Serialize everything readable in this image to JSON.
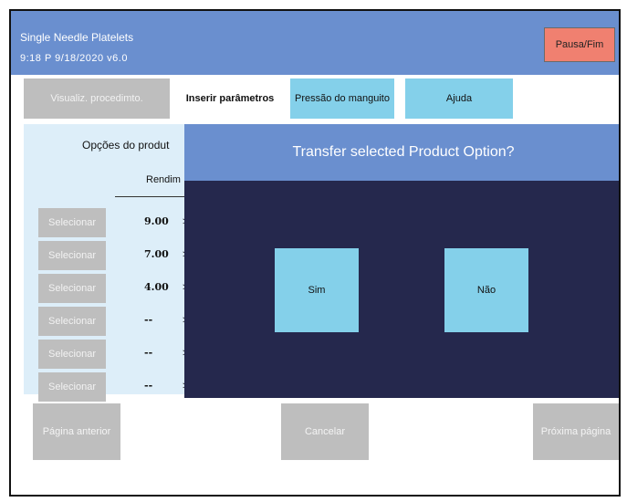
{
  "header": {
    "app_title": "Single Needle Platelets",
    "status_line": "9:18 P  9/18/2020   v6.0",
    "pause_label": "Pausa/Fim"
  },
  "tabs": [
    {
      "label": "Visualiz. procedimto."
    },
    {
      "label": "Inserir parâmetros"
    },
    {
      "label": "Pressão do manguito"
    },
    {
      "label": "Ajuda"
    }
  ],
  "options": {
    "title": "Opções do produt",
    "column_header": "Rendim",
    "rows": [
      {
        "select_label": "Selecionar",
        "value": "9.00"
      },
      {
        "select_label": "Selecionar",
        "value": "7.00"
      },
      {
        "select_label": "Selecionar",
        "value": "4.00"
      },
      {
        "select_label": "Selecionar",
        "value": "--"
      },
      {
        "select_label": "Selecionar",
        "value": "--"
      },
      {
        "select_label": "Selecionar",
        "value": "--"
      }
    ]
  },
  "footer": {
    "prev_label": "Página anterior",
    "cancel_label": "Cancelar",
    "next_label": "Próxima página"
  },
  "dialog": {
    "title": "Transfer selected Product Option?",
    "yes_label": "Sim",
    "no_label": "Não"
  },
  "colors": {
    "header_blue": "#6a8fcf",
    "pause_red": "#f08070",
    "tab_cyan": "#84d0ea",
    "disabled_gray": "#bebebe",
    "dialog_navy": "#25284d"
  }
}
